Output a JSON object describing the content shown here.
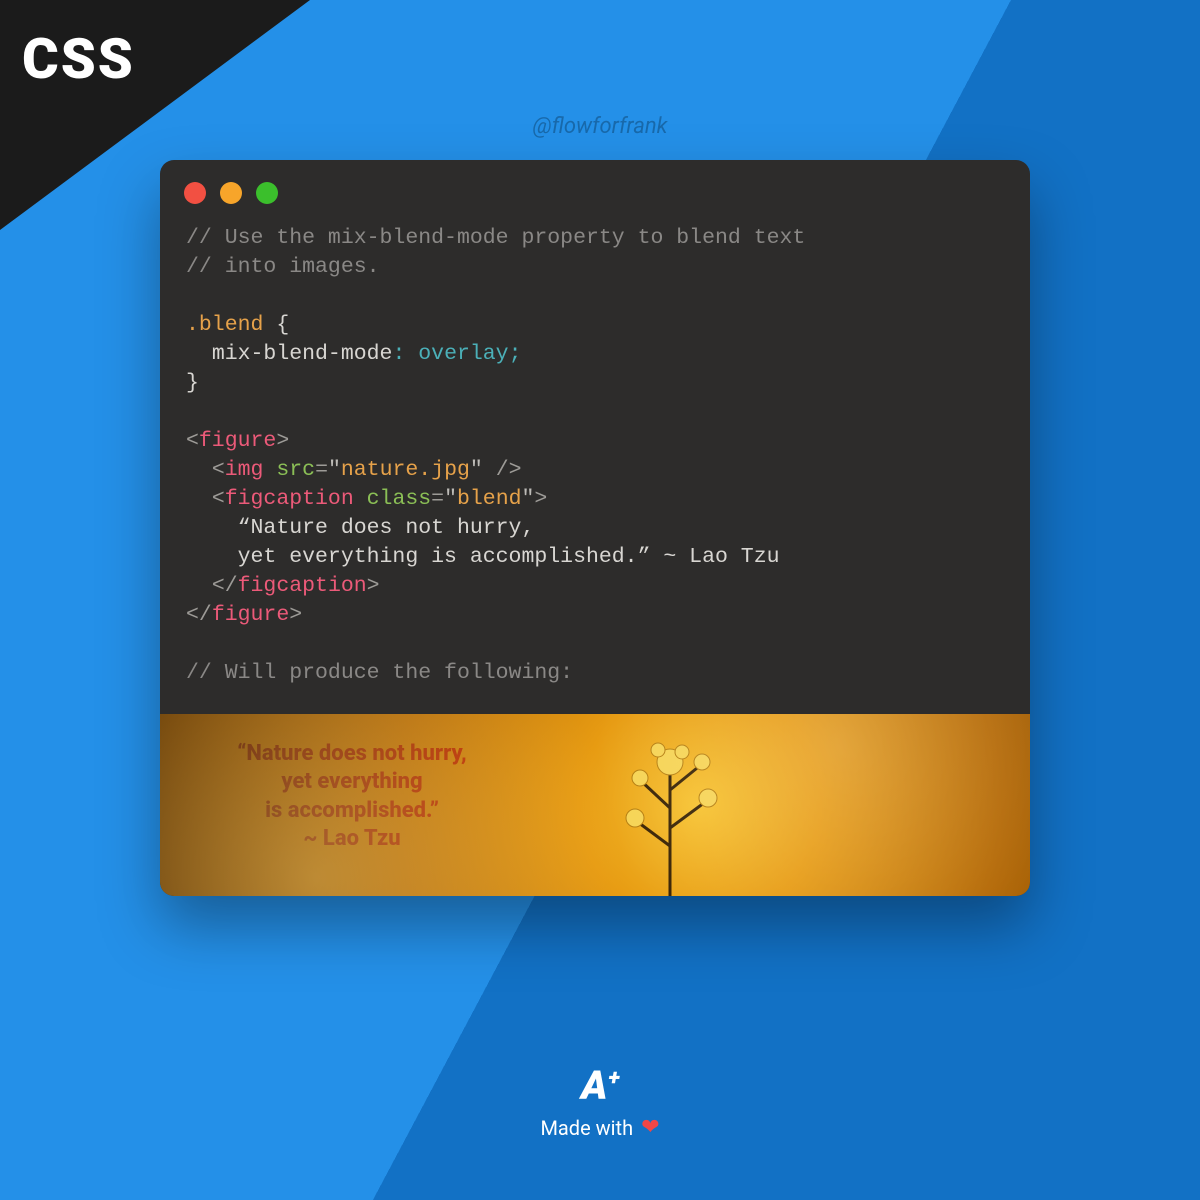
{
  "corner": {
    "label": "CSS"
  },
  "handle": "@flowforfrank",
  "window": {
    "dots": {
      "red": "#f25042",
      "yellow": "#f7a52a",
      "green": "#3bbf2c"
    }
  },
  "code": {
    "comment1": "// Use the mix-blend-mode property to blend text",
    "comment2": "// into images.",
    "selector": ".blend",
    "brace_open": " {",
    "prop": "mix-blend-mode",
    "colon": ": ",
    "value": "overlay",
    "semicolon": ";",
    "brace_close": "}",
    "lt": "<",
    "gt": ">",
    "slash": "/",
    "figure": "figure",
    "img": "img",
    "src_attr": "src",
    "eq": "=",
    "q": "\"",
    "src_val": "nature.jpg",
    "selfclose": " />",
    "figcaption": "figcaption",
    "class_attr": "class",
    "class_val": "blend",
    "quote_l1": "    “Nature does not hurry,",
    "quote_l2": "    yet everything is accomplished.” ~ Lao Tzu",
    "comment3": "// Will produce the following:"
  },
  "result": {
    "line1": "“Nature does not hurry,",
    "line2": "yet everything",
    "line3": "is accomplished.”",
    "line4": "~ Lao Tzu"
  },
  "footer": {
    "logo_main": "A",
    "logo_plus": "+",
    "made": "Made with",
    "heart": "❤"
  }
}
